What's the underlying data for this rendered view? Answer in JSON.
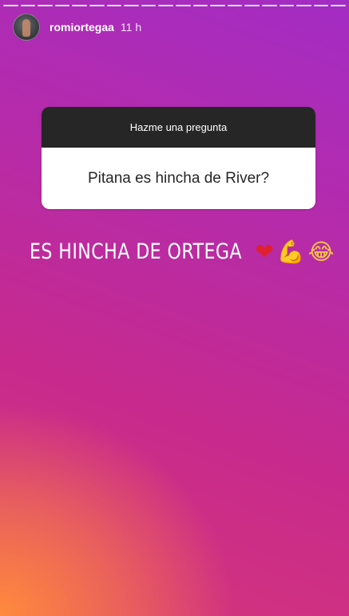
{
  "story": {
    "progress_segments": 20,
    "user": {
      "username": "romiortegaa",
      "time": "11 h"
    },
    "question_sticker": {
      "title": "Hazme una pregunta",
      "question": "Pitana es hincha de River?"
    },
    "answer": {
      "text": "ES HINCHA DE ORTEGA",
      "emojis": {
        "heart": "❤",
        "flexed_biceps": "💪",
        "tears_of_joy": "😂"
      }
    }
  }
}
